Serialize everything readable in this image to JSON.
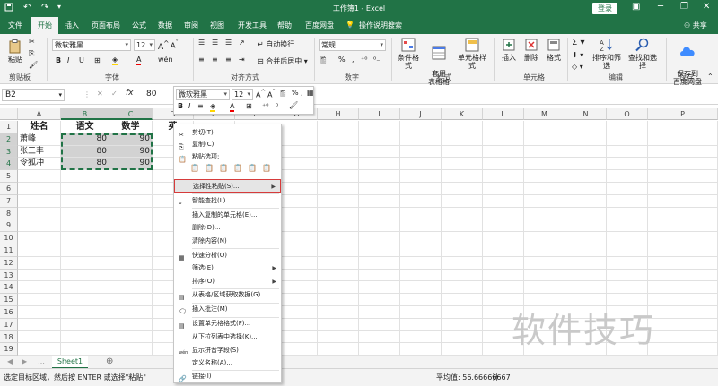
{
  "titlebar": {
    "title": "工作簿1 - Excel",
    "login": "登录"
  },
  "menu": {
    "tabs": [
      "文件",
      "开始",
      "插入",
      "页面布局",
      "公式",
      "数据",
      "审阅",
      "视图",
      "开发工具",
      "帮助",
      "百度网盘"
    ],
    "search": "操作说明搜索",
    "share": "共享"
  },
  "ribbon": {
    "clipboard": {
      "paste": "粘贴",
      "label": "剪贴板"
    },
    "font": {
      "name": "微软雅黑",
      "size": "12",
      "label": "字体",
      "bold": "B",
      "italic": "I",
      "underline": "U"
    },
    "align": {
      "wrap": "自动换行",
      "merge": "合并后居中",
      "label": "对齐方式"
    },
    "number": {
      "format": "常规",
      "label": "数字"
    },
    "styles": {
      "conditional": "条件格式",
      "table": "套用\n表格格式",
      "cell": "单元格样式",
      "label": "样式"
    },
    "cells": {
      "insert": "插入",
      "delete": "删除",
      "format": "格式",
      "label": "单元格"
    },
    "editing": {
      "sort": "排序和筛选",
      "find": "查找和选择",
      "label": "编辑"
    },
    "save": {
      "saveto": "保存到\n百度网盘",
      "label": "保存"
    }
  },
  "formulabar": {
    "namebox": "B2",
    "value": "80"
  },
  "minitoolbar": {
    "font": "微软雅黑",
    "size": "12"
  },
  "grid": {
    "columns": [
      "A",
      "B",
      "C",
      "D",
      "E",
      "F",
      "G",
      "H",
      "I",
      "J",
      "K",
      "L",
      "M",
      "N",
      "O",
      "P"
    ],
    "rows": [
      "1",
      "2",
      "3",
      "4",
      "5",
      "6",
      "7",
      "8",
      "9",
      "10",
      "11",
      "12",
      "13",
      "14",
      "15",
      "16",
      "17",
      "18",
      "19"
    ],
    "header_row": [
      "姓名",
      "语文",
      "数学",
      "英"
    ],
    "data": [
      [
        "萧峰",
        "80",
        "90"
      ],
      [
        "张三丰",
        "80",
        "90"
      ],
      [
        "令狐冲",
        "80",
        "90"
      ]
    ]
  },
  "context_menu": {
    "items": [
      {
        "label": "剪切(T)",
        "icon": "scissors-icon"
      },
      {
        "label": "复制(C)",
        "icon": "copy-icon"
      },
      {
        "label": "粘贴选项:",
        "icon": "paste-icon"
      },
      {
        "label": "选择性粘贴(S)...",
        "icon": "",
        "submenu": true,
        "highlight": true
      },
      {
        "label": "智能查找(L)",
        "icon": "search-icon"
      },
      {
        "label": "插入复制的单元格(E)...",
        "icon": ""
      },
      {
        "label": "删除(D)...",
        "icon": ""
      },
      {
        "label": "清除内容(N)",
        "icon": ""
      },
      {
        "label": "快速分析(Q)",
        "icon": "quick-analysis-icon"
      },
      {
        "label": "筛选(E)",
        "icon": "",
        "submenu": true
      },
      {
        "label": "排序(O)",
        "icon": "",
        "submenu": true
      },
      {
        "label": "从表格/区域获取数据(G)...",
        "icon": "table-icon"
      },
      {
        "label": "插入批注(M)",
        "icon": "comment-icon"
      },
      {
        "label": "设置单元格格式(F)...",
        "icon": "format-cells-icon"
      },
      {
        "label": "从下拉列表中选择(K)...",
        "icon": ""
      },
      {
        "label": "显示拼音字段(S)",
        "icon": "phonetic-icon"
      },
      {
        "label": "定义名称(A)...",
        "icon": ""
      },
      {
        "label": "链接(I)",
        "icon": "link-icon"
      }
    ]
  },
  "sheets": {
    "active": "Sheet1"
  },
  "status": {
    "left": "选定目标区域，然后按 ENTER 或选择\"粘贴\"",
    "average": "平均值: 56.66666667",
    "count": "计"
  },
  "watermark": "软件技巧",
  "colors": {
    "brand": "#217346",
    "highlight_border": "#d63b3b"
  }
}
